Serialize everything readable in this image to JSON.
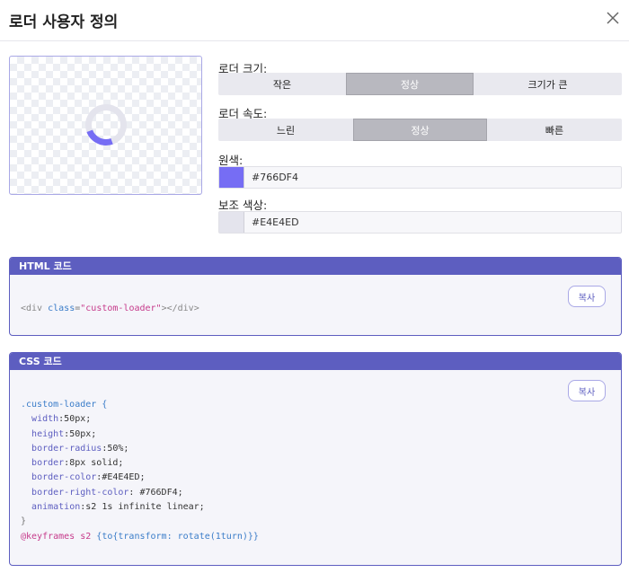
{
  "dialog": {
    "title": "로더 사용자 정의"
  },
  "preview": {
    "loader_primary": "#766DF4",
    "loader_secondary": "#E4E4ED"
  },
  "size": {
    "label": "로더 크기:",
    "options": [
      "작은",
      "정상",
      "크기가 큰"
    ],
    "selected": "정상"
  },
  "speed": {
    "label": "로더 속도:",
    "options": [
      "느린",
      "정상",
      "빠른"
    ],
    "selected": "정상"
  },
  "primary_color": {
    "label": "원색:",
    "value": "#766DF4"
  },
  "secondary_color": {
    "label": "보조 색상:",
    "value": "#E4E4ED"
  },
  "html_panel": {
    "title": "HTML 코드",
    "copy_label": "복사",
    "code": {
      "open_tag": "<div",
      "attr": "class",
      "eq": "=",
      "value": "\"custom-loader\"",
      "close": "></div>"
    }
  },
  "css_panel": {
    "title": "CSS 코드",
    "copy_label": "복사",
    "selector": ".custom-loader {",
    "decls": [
      {
        "prop": "width",
        "val": ":50px;"
      },
      {
        "prop": "height",
        "val": ":50px;"
      },
      {
        "prop": "border-radius",
        "val": ":50%;"
      },
      {
        "prop": "border",
        "val": ":8px solid;"
      },
      {
        "prop": "border-color",
        "val": ":#E4E4ED;"
      },
      {
        "prop": "border-right-color",
        "val": ": #766DF4;"
      },
      {
        "prop": "animation",
        "val": ":s2 1s infinite linear;"
      }
    ],
    "close_brace": "}",
    "keyframes_kw": "@keyframes s2",
    "keyframes_body": " {to{transform: rotate(1turn)}}"
  },
  "colors": {
    "accent": "#5D5EC0",
    "primary": "#766DF4",
    "secondary": "#E4E4ED"
  }
}
